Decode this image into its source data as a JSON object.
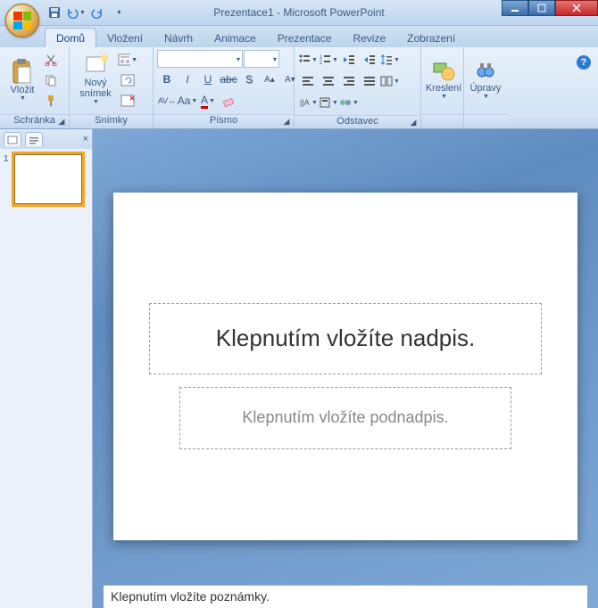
{
  "titlebar": {
    "document": "Prezentace1",
    "app": "Microsoft PowerPoint"
  },
  "qat": {
    "save": "save",
    "undo": "undo",
    "redo": "redo"
  },
  "tabs": {
    "home": "Domů",
    "insert": "Vložení",
    "design": "Návrh",
    "animations": "Animace",
    "slideshow": "Prezentace",
    "review": "Revize",
    "view": "Zobrazení"
  },
  "ribbon": {
    "clipboard": {
      "label": "Schránka",
      "paste": "Vložit"
    },
    "slides": {
      "label": "Snímky",
      "new_slide_1": "Nový",
      "new_slide_2": "snímek"
    },
    "font": {
      "label": "Písmo",
      "name_placeholder": "",
      "size_placeholder": ""
    },
    "paragraph": {
      "label": "Odstavec"
    },
    "drawing": {
      "label": "Kreslení"
    },
    "editing": {
      "label": "Úpravy"
    }
  },
  "thumbnails": {
    "slide1_num": "1"
  },
  "slide": {
    "title_placeholder": "Klepnutím vložíte nadpis.",
    "subtitle_placeholder": "Klepnutím vložíte podnadpis."
  },
  "notes": {
    "placeholder": "Klepnutím vložíte poznámky."
  }
}
